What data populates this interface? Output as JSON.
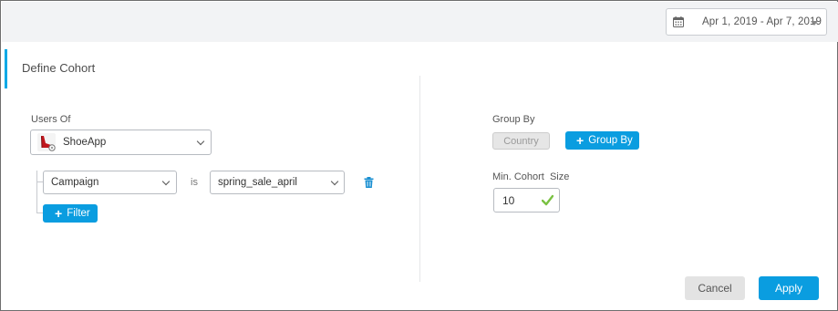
{
  "header": {
    "date_range": "Apr 1, 2019 - Apr 7, 2019",
    "calendar_icon": "calendar-icon",
    "dropdown_icon": "caret-down-icon"
  },
  "panel": {
    "title": "Define Cohort"
  },
  "left": {
    "users_of_label": "Users Of",
    "app": {
      "name": "ShoeApp",
      "icon": "shoe-app-icon"
    },
    "filter_row": {
      "field": "Campaign",
      "operator": "is",
      "value": "spring_sale_april",
      "delete_icon": "trash-icon"
    },
    "add_filter_label": "Filter"
  },
  "right": {
    "group_by_label": "Group By",
    "group_chip": "Country",
    "add_group_by_label": "Group By",
    "min_cohort_label": "Min. Cohort  Size",
    "min_cohort_value": "10",
    "valid_icon": "check-icon"
  },
  "footer": {
    "cancel_label": "Cancel",
    "apply_label": "Apply"
  },
  "colors": {
    "accent": "#0a9de0",
    "topbar_bg": "#f2f3f5",
    "valid_check": "#7ac142",
    "delete_icon": "#1a8fd1",
    "chip_bg": "#e6e6e6"
  }
}
